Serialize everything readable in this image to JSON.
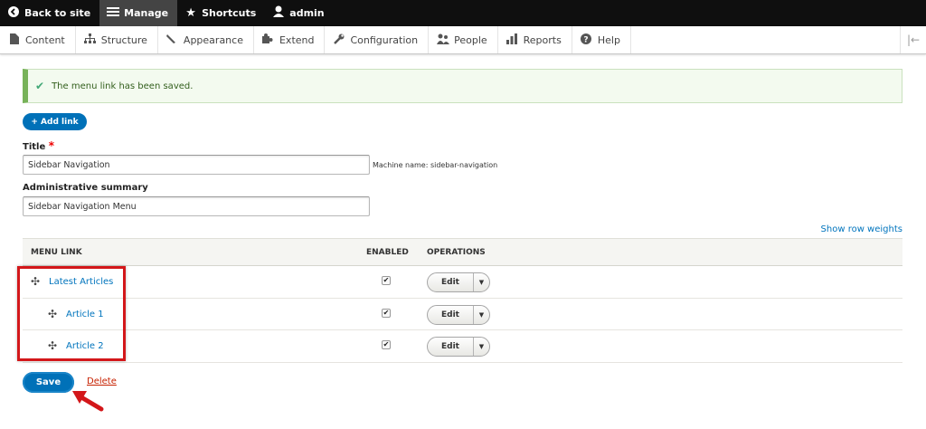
{
  "toolbar": {
    "back": "Back to site",
    "manage": "Manage",
    "shortcuts": "Shortcuts",
    "user": "admin"
  },
  "tray": {
    "items": [
      "Content",
      "Structure",
      "Appearance",
      "Extend",
      "Configuration",
      "People",
      "Reports",
      "Help"
    ]
  },
  "message": "The menu link has been saved.",
  "add_link": "+ Add link",
  "form": {
    "title_label": "Title",
    "required_mark": "*",
    "title_value": "Sidebar Navigation",
    "machine_name": "Machine name: sidebar-navigation",
    "summary_label": "Administrative summary",
    "summary_value": "Sidebar Navigation Menu"
  },
  "show_row_weights": "Show row weights",
  "table": {
    "headers": {
      "menu_link": "MENU LINK",
      "enabled": "ENABLED",
      "operations": "OPERATIONS"
    },
    "rows": [
      {
        "title": "Latest Articles",
        "enabled": true,
        "op": "Edit"
      },
      {
        "title": "Article 1",
        "enabled": true,
        "op": "Edit"
      },
      {
        "title": "Article 2",
        "enabled": true,
        "op": "Edit"
      }
    ]
  },
  "actions": {
    "save": "Save",
    "delete": "Delete"
  },
  "colors": {
    "accent": "#0071b8",
    "highlight": "#d3171a",
    "status_ok": "#77b259"
  }
}
